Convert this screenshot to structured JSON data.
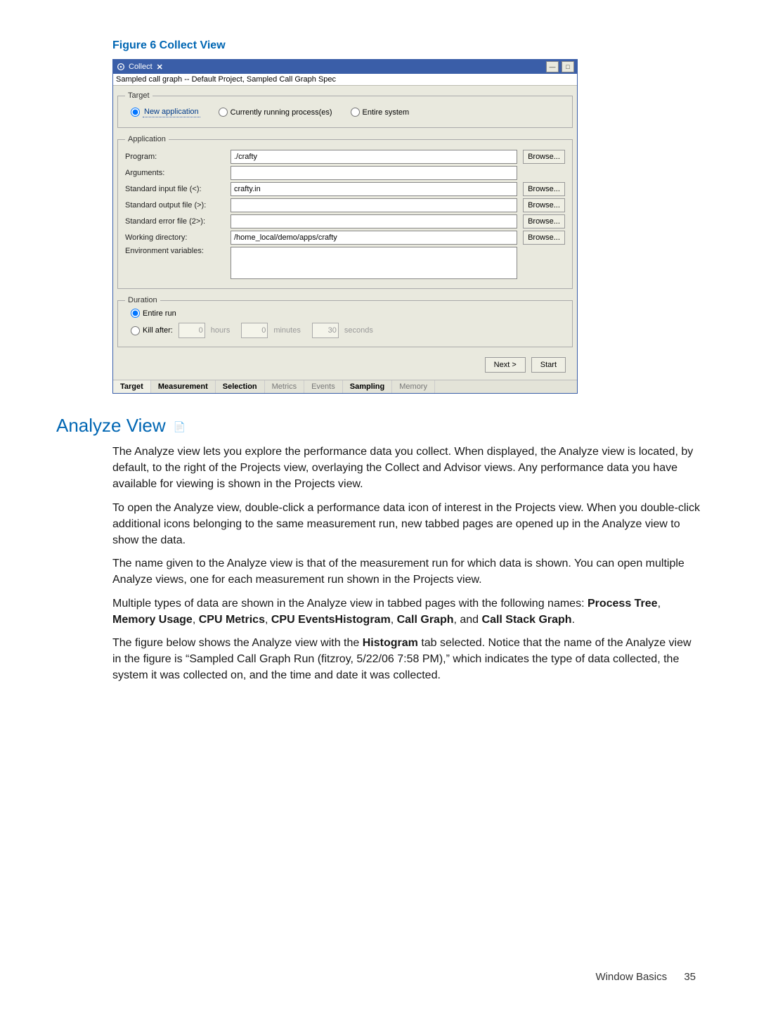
{
  "figure_caption": "Figure 6 Collect View",
  "window": {
    "title": "Collect",
    "subtitle": "Sampled call graph -- Default Project, Sampled Call Graph Spec",
    "target": {
      "legend": "Target",
      "opts": {
        "new_app": "New application",
        "running": "Currently running process(es)",
        "entire": "Entire system"
      }
    },
    "app": {
      "legend": "Application",
      "labels": {
        "program": "Program:",
        "arguments": "Arguments:",
        "stdin": "Standard input file (<):",
        "stdout": "Standard output file (>):",
        "stderr": "Standard error file (2>):",
        "wd": "Working directory:",
        "env": "Environment variables:"
      },
      "values": {
        "program": "./crafty",
        "arguments": "",
        "stdin": "crafty.in",
        "stdout": "",
        "stderr": "",
        "wd": "/home_local/demo/apps/crafty",
        "env": ""
      },
      "browse": "Browse..."
    },
    "duration": {
      "legend": "Duration",
      "entire": "Entire run",
      "kill_label": "Kill after:",
      "hours": "0",
      "minutes": "0",
      "seconds": "30",
      "u_hours": "hours",
      "u_minutes": "minutes",
      "u_seconds": "seconds"
    },
    "buttons": {
      "next": "Next >",
      "start": "Start"
    },
    "tabs": [
      "Target",
      "Measurement",
      "Selection",
      "Metrics",
      "Events",
      "Sampling",
      "Memory"
    ]
  },
  "section_title": "Analyze View",
  "paragraphs": {
    "p1": "The Analyze view lets you explore the performance data you collect. When displayed, the Analyze view is located, by default, to the right of the Projects view, overlaying the Collect and Advisor views. Any performance data you have available for viewing is shown in the Projects view.",
    "p2": "To open the Analyze view, double-click a performance data icon of interest in the Projects view. When you double-click additional icons belonging to the same measurement run, new tabbed pages are opened up in the Analyze view to show the data.",
    "p3": "The name given to the Analyze view is that of the measurement run for which data is shown. You can open multiple Analyze views, one for each measurement run shown in the Projects view.",
    "p4_a": "Multiple types of data are shown in the Analyze view in tabbed pages with the following names: ",
    "p4_b1": "Process Tree",
    "p4_c1": ", ",
    "p4_b2": "Memory Usage",
    "p4_c2": ", ",
    "p4_b3": "CPU Metrics",
    "p4_c3": ", ",
    "p4_b4": "CPU EventsHistogram",
    "p4_c4": ", ",
    "p4_b5": "Call Graph",
    "p4_c5": ", and ",
    "p4_b6": "Call Stack Graph",
    "p4_c6": ".",
    "p5_a": "The figure below shows the Analyze view with the ",
    "p5_b": "Histogram",
    "p5_c": " tab selected. Notice that the name of the Analyze view in the figure is “Sampled Call Graph Run (fitzroy, 5/22/06 7:58 PM),” which indicates the type of data collected, the system it was collected on, and the time and date it was collected."
  },
  "footer": {
    "label": "Window Basics",
    "page": "35"
  }
}
